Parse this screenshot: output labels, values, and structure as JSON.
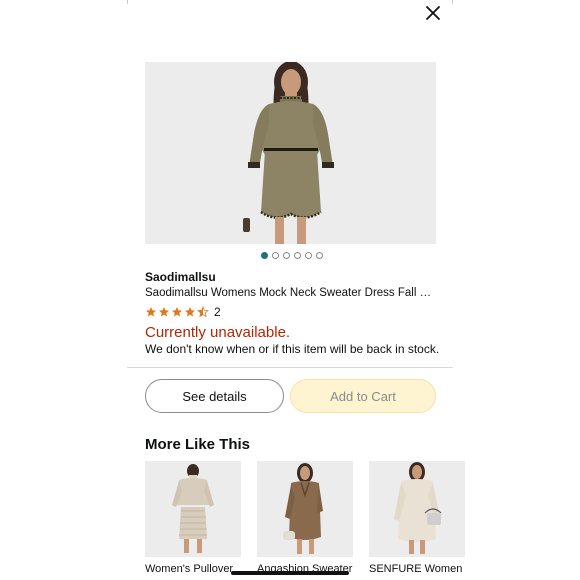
{
  "header": {
    "close_icon": "close-icon"
  },
  "product": {
    "brand": "Saodimallsu",
    "title": "Saodimallsu Womens Mock Neck Sweater Dress Fall Chunk…",
    "rating_value": 4.5,
    "rating_max": 5,
    "rating_count": "2",
    "availability": "Currently unavailable.",
    "restock_note": "We don't know when or if this item will be back in stock.",
    "image_index": 1,
    "image_count": 6
  },
  "actions": {
    "details_label": "See details",
    "cart_label": "Add to Cart"
  },
  "more_like_this": {
    "title": "More Like This",
    "items": [
      {
        "label": "Women's Pullover"
      },
      {
        "label": "Angashion Sweater"
      },
      {
        "label": "SENFURE Women"
      }
    ]
  },
  "colors": {
    "unavailable": "#b12704",
    "star": "#de7921",
    "active_dot": "#1e6f87",
    "cart_button": "#fff4d1"
  }
}
